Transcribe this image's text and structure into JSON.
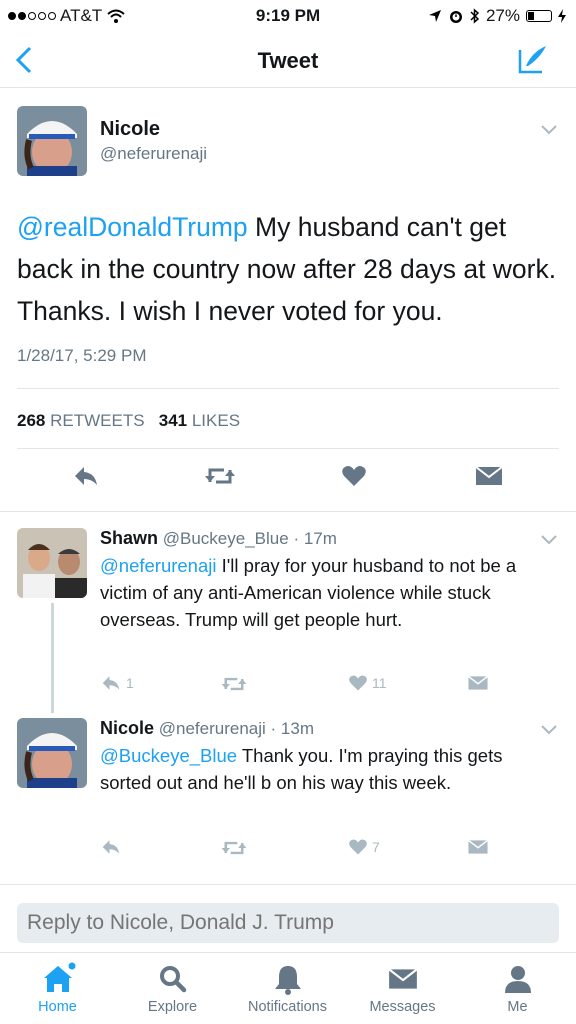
{
  "status_bar": {
    "carrier": "AT&T",
    "time": "9:19 PM",
    "battery": "27%"
  },
  "nav": {
    "title": "Tweet"
  },
  "main_tweet": {
    "name": "Nicole",
    "handle": "@neferurenaji",
    "mention": "@realDonaldTrump",
    "text": " My husband can't get back in the country now after 28 days at work.  Thanks.  I wish I never voted for you.",
    "timestamp": "1/28/17, 5:29 PM",
    "retweets_count": "268",
    "retweets_label": "RETWEETS",
    "likes_count": "341",
    "likes_label": "LIKES"
  },
  "replies": [
    {
      "name": "Shawn",
      "handle": "@Buckeye_Blue",
      "time": "· 17m",
      "mention": "@neferurenaji",
      "text": "  I'll pray for your husband to not be a victim of any anti-American violence while stuck overseas. Trump will get people hurt.",
      "reply_count": "1",
      "retweet_count": "",
      "like_count": "11"
    },
    {
      "name": "Nicole",
      "handle": "@neferurenaji",
      "time": "· 13m",
      "mention": "@Buckeye_Blue",
      "text": " Thank you.  I'm praying this gets sorted out and he'll b on his way this week.",
      "reply_count": "",
      "retweet_count": "",
      "like_count": "7"
    }
  ],
  "reply_bar": {
    "placeholder": "Reply to Nicole, Donald J. Trump"
  },
  "tabs": [
    {
      "label": "Home",
      "icon": "home-icon"
    },
    {
      "label": "Explore",
      "icon": "search-icon"
    },
    {
      "label": "Notifications",
      "icon": "bell-icon"
    },
    {
      "label": "Messages",
      "icon": "envelope-icon"
    },
    {
      "label": "Me",
      "icon": "person-icon"
    }
  ],
  "colors": {
    "accent": "#1da1f2",
    "secondary_text": "#657786",
    "muted_icon": "#aab8c2"
  }
}
